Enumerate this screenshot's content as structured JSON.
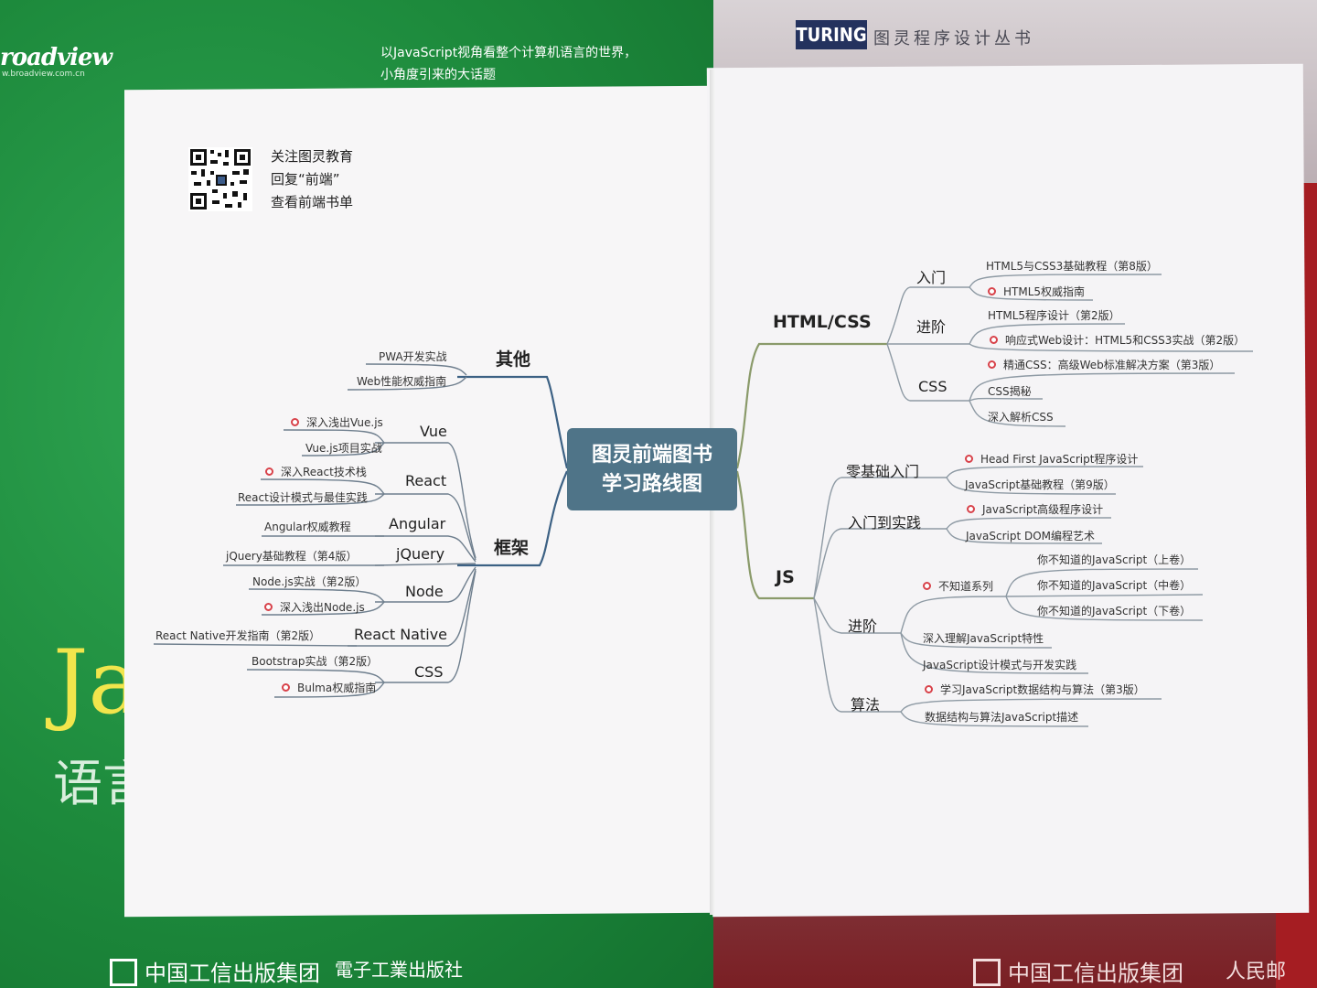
{
  "background": {
    "left_book": {
      "brand": "roadview",
      "brand_url": "w.broadview.com.cn",
      "tagline_line1": "以JavaScript视角看整个计算机语言的世界，",
      "tagline_line2": "小角度引来的大话题",
      "cover_big_text": "Ja",
      "cover_subtitle": "语言",
      "publisher": "中国工信出版集团",
      "publisher2": "電子工業出版社"
    },
    "right_book": {
      "logo": "TURING",
      "series": "图灵程序设计丛书",
      "publisher": "中国工信出版集团",
      "publisher2": "人民邮"
    }
  },
  "qr": {
    "line1": "关注图灵教育",
    "line2": "回复“前端”",
    "line3": "查看前端书单"
  },
  "center": {
    "line1": "图灵前端图书",
    "line2": "学习路线图"
  },
  "colors": {
    "center_node": "#4f7488",
    "branch_blue": "#3c6184",
    "branch_olive": "#8a9a6a",
    "dot_red": "#d8424a"
  },
  "left": {
    "other": {
      "title": "其他",
      "books": [
        "PWA开发实战",
        "Web性能权威指南"
      ]
    },
    "frameworks": {
      "title": "框架",
      "groups": [
        {
          "name": "Vue",
          "books": [
            {
              "t": "深入浅出Vue.js",
              "dot": true
            },
            {
              "t": "Vue.js项目实战",
              "dot": false
            }
          ]
        },
        {
          "name": "React",
          "books": [
            {
              "t": "深入React技术栈",
              "dot": true
            },
            {
              "t": "React设计模式与最佳实践",
              "dot": false
            }
          ]
        },
        {
          "name": "Angular",
          "books": [
            {
              "t": "Angular权威教程",
              "dot": false
            }
          ]
        },
        {
          "name": "jQuery",
          "books": [
            {
              "t": "jQuery基础教程（第4版）",
              "dot": false
            }
          ]
        },
        {
          "name": "Node",
          "books": [
            {
              "t": "Node.js实战（第2版）",
              "dot": false
            },
            {
              "t": "深入浅出Node.js",
              "dot": true
            }
          ]
        },
        {
          "name": "React Native",
          "books": [
            {
              "t": "React Native开发指南（第2版）",
              "dot": false
            }
          ]
        },
        {
          "name": "CSS",
          "books": [
            {
              "t": "Bootstrap实战（第2版）",
              "dot": false
            },
            {
              "t": "Bulma权威指南",
              "dot": true
            }
          ]
        }
      ]
    }
  },
  "right": {
    "htmlcss": {
      "title": "HTML/CSS",
      "groups": [
        {
          "name": "入门",
          "books": [
            {
              "t": "HTML5与CSS3基础教程（第8版）",
              "dot": false
            },
            {
              "t": "HTML5权威指南",
              "dot": true
            }
          ]
        },
        {
          "name": "进阶",
          "books": [
            {
              "t": "HTML5程序设计（第2版）",
              "dot": false
            },
            {
              "t": "响应式Web设计：HTML5和CSS3实战（第2版）",
              "dot": true
            }
          ]
        },
        {
          "name": "CSS",
          "books": [
            {
              "t": "精通CSS：高级Web标准解决方案（第3版）",
              "dot": true
            },
            {
              "t": "CSS揭秘",
              "dot": false
            },
            {
              "t": "深入解析CSS",
              "dot": false
            }
          ]
        }
      ]
    },
    "js": {
      "title": "JS",
      "groups": [
        {
          "name": "零基础入门",
          "books": [
            {
              "t": "Head First JavaScript程序设计",
              "dot": true
            },
            {
              "t": "JavaScript基础教程（第9版）",
              "dot": false
            }
          ]
        },
        {
          "name": "入门到实践",
          "books": [
            {
              "t": "JavaScript高级程序设计",
              "dot": true
            },
            {
              "t": "JavaScript DOM编程艺术",
              "dot": false
            }
          ]
        },
        {
          "name": "进阶",
          "series": "不知道系列",
          "series_books": [
            "你不知道的JavaScript（上卷）",
            "你不知道的JavaScript（中卷）",
            "你不知道的JavaScript（下卷）"
          ],
          "books": [
            {
              "t": "深入理解JavaScript特性",
              "dot": false
            },
            {
              "t": "JavaScript设计模式与开发实践",
              "dot": false
            }
          ]
        },
        {
          "name": "算法",
          "books": [
            {
              "t": "学习JavaScript数据结构与算法（第3版）",
              "dot": true
            },
            {
              "t": "数据结构与算法JavaScript描述",
              "dot": false
            }
          ]
        }
      ]
    }
  }
}
